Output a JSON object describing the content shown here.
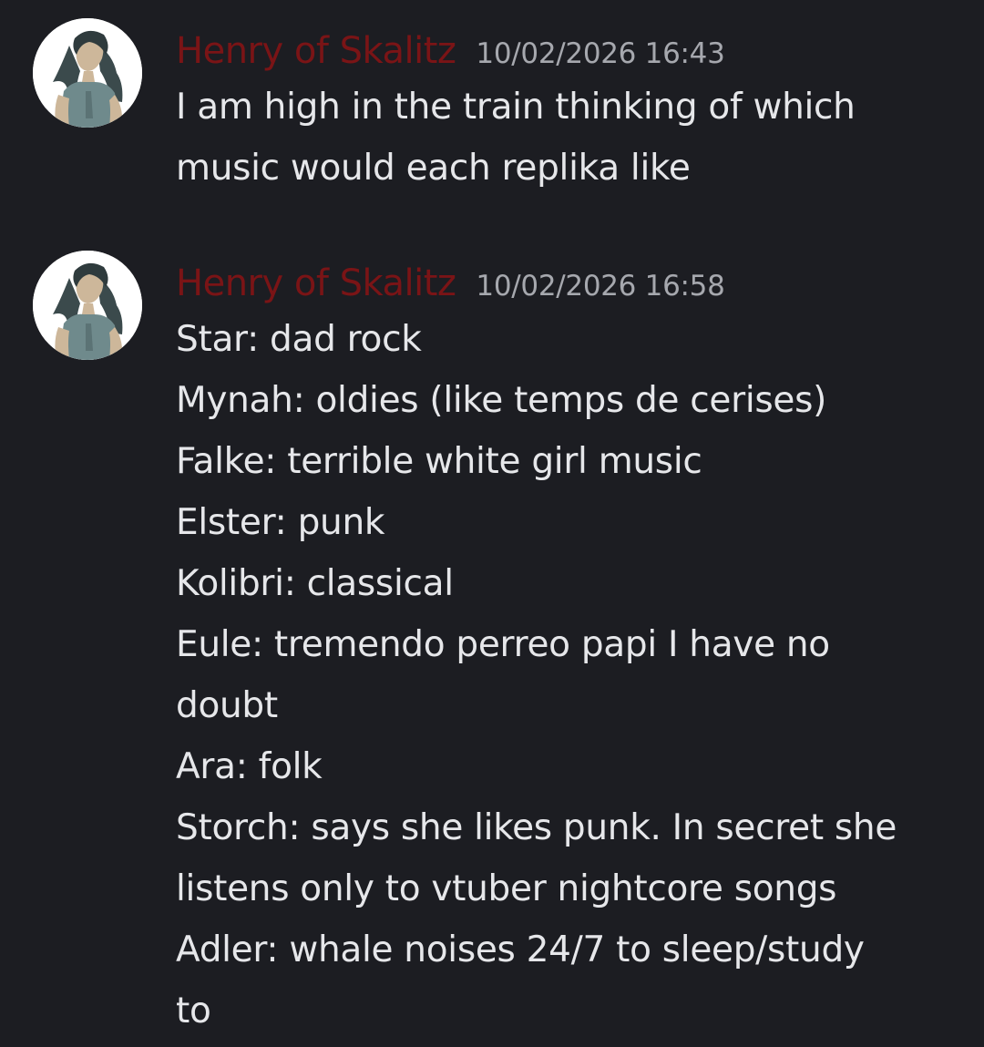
{
  "messages": [
    {
      "author": "Henry of Skalitz",
      "timestamp": "10/02/2026 16:43",
      "lines": [
        "I am high in the train thinking of which",
        "music would each replika like"
      ]
    },
    {
      "author": "Henry of Skalitz",
      "timestamp": "10/02/2026 16:58",
      "lines": [
        "Star: dad rock",
        "Mynah: oldies (like temps de cerises)",
        "Falke: terrible white girl music",
        "Elster: punk",
        "Kolibri: classical",
        "Eule: tremendo perreo papi I have no",
        "doubt",
        "Ara: folk",
        "Storch: says she likes punk. In secret she",
        "listens only to vtuber nightcore songs",
        "Adler: whale noises 24/7 to sleep/study",
        "to"
      ]
    }
  ],
  "colors": {
    "background": "#1c1d22",
    "author": "#7a1416",
    "timestamp": "#a6a8ae",
    "text": "#e6e7ea"
  },
  "icons": {
    "avatar": "user-avatar-illustration"
  }
}
